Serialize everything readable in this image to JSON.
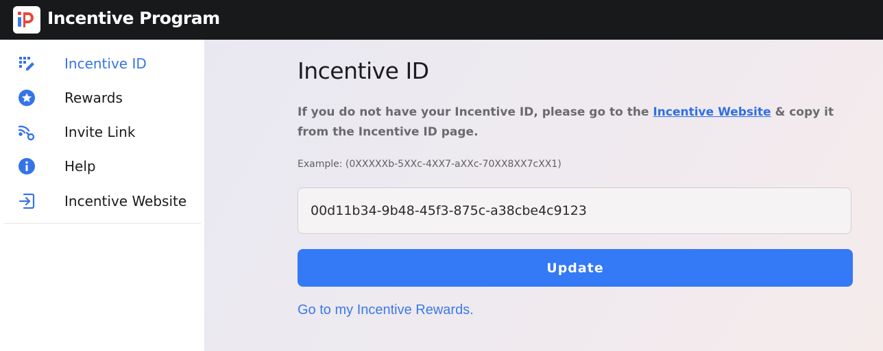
{
  "app": {
    "title": "Incentive Program"
  },
  "sidebar": {
    "items": [
      {
        "label": "Incentive ID",
        "icon": "grid-pen-icon",
        "active": true
      },
      {
        "label": "Rewards",
        "icon": "star-badge-icon",
        "active": false
      },
      {
        "label": "Invite Link",
        "icon": "wifi-share-icon",
        "active": false
      },
      {
        "label": "Help",
        "icon": "info-icon",
        "active": false
      },
      {
        "label": "Incentive Website",
        "icon": "login-arrow-icon",
        "active": false
      }
    ]
  },
  "main": {
    "heading": "Incentive ID",
    "description_before": "If you do not have your Incentive ID, please go to the ",
    "description_link": "Incentive Website",
    "description_after": " & copy it from the Incentive ID page.",
    "example": "Example: (0XXXXXb-5XXc-4XX7-aXXc-70XX8XX7cXX1)",
    "input_value": "00d11b34-9b48-45f3-875c-a38cbe4c9123",
    "update_label": "Update",
    "rewards_link": "Go to my Incentive Rewards."
  },
  "colors": {
    "accent": "#3479f6",
    "topbar": "#18191b",
    "active_nav": "#3574e8"
  }
}
